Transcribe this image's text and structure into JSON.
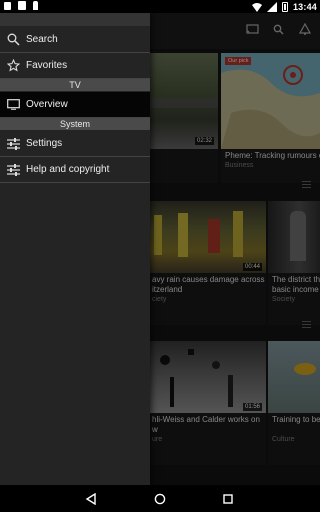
{
  "status_bar": {
    "time": "13:44",
    "icons": [
      "notification-icon",
      "sim-icon",
      "download-icon"
    ]
  },
  "drawer": {
    "items": [
      {
        "label": "Search",
        "icon": "search-icon"
      },
      {
        "label": "Favorites",
        "icon": "star-icon"
      }
    ],
    "section_tv": "TV",
    "overview": {
      "label": "Overview",
      "icon": "tv-icon"
    },
    "section_system": "System",
    "system_items": [
      {
        "label": "Settings",
        "icon": "sliders-icon"
      },
      {
        "label": "Help and copyright",
        "icon": "sliders-icon"
      }
    ]
  },
  "content": {
    "cards": [
      {
        "title": "",
        "category": "",
        "duration": "02:32"
      },
      {
        "badge": "Our pick",
        "title": "Pheme: Tracking rumours o",
        "category": "Business"
      },
      {
        "title": "avy rain causes damage across",
        "title2": "itzerland",
        "category": "ciety",
        "duration": "00:44"
      },
      {
        "title": "The district the",
        "title2": "basic income",
        "category": "Society"
      },
      {
        "title": "hli-Weiss and Calder works on",
        "title2": "w",
        "category": "ure",
        "duration": "01:56"
      },
      {
        "title": "Training to bec",
        "category": "Culture"
      }
    ]
  }
}
